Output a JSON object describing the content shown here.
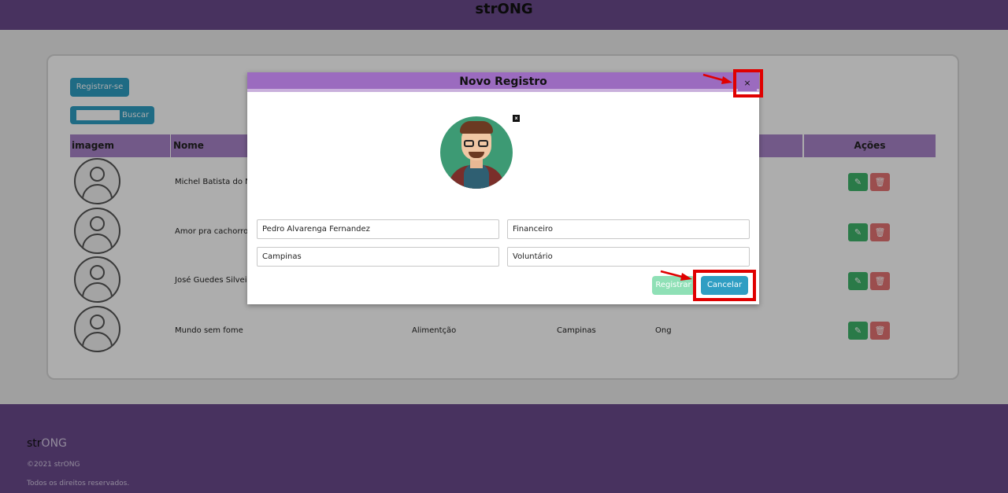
{
  "header": {
    "brand": "strONG"
  },
  "toolbar": {
    "register_label": "Registrar-se",
    "search_label": "Buscar",
    "search_value": ""
  },
  "table": {
    "columns": {
      "image": "imagem",
      "name": "Nome",
      "actions": "Ações"
    },
    "rows": [
      {
        "name": "Michel Batista do N"
      },
      {
        "name": "Amor pra cachorro"
      },
      {
        "name": "José Guedes Silveir"
      },
      {
        "name": "Mundo sem fome",
        "area": "Alimentção",
        "city": "Campinas",
        "type": "Ong"
      }
    ],
    "edit_icon": "✎",
    "delete_icon": "🗑"
  },
  "modal": {
    "title": "Novo Registro",
    "close_label": "×",
    "remove_photo_label": "x",
    "fields": {
      "name": "Pedro Alvarenga Fernandez",
      "area": "Financeiro",
      "city": "Campinas",
      "type": "Voluntário"
    },
    "register_label": "Registrar",
    "cancel_label": "Cancelar"
  },
  "footer": {
    "brand_prefix": "str",
    "brand_suffix": "ONG",
    "copyright": "©2021 strONG",
    "rights": "Todos os direitos reservados."
  },
  "colors": {
    "purple_bar": "#6a4a8c",
    "modal_header": "#9b6bbf",
    "accent_blue": "#2f9ec3",
    "highlight_red": "#e00000"
  }
}
